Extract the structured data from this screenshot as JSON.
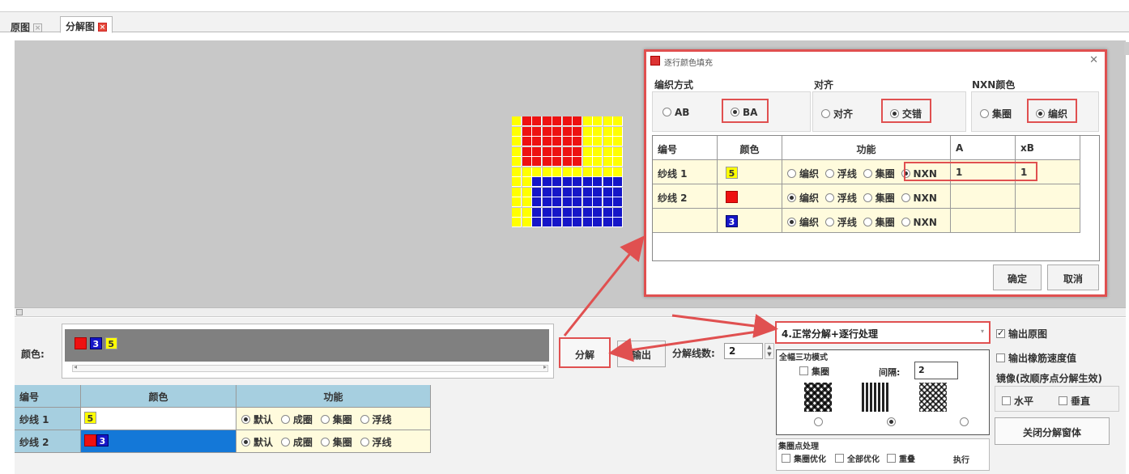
{
  "tabs": [
    {
      "label": "原图"
    },
    {
      "label": "分解图"
    }
  ],
  "dialog": {
    "title": "逐行颜色填充",
    "groups": {
      "weave": {
        "label": "编织方式",
        "options": [
          "AB",
          "BA"
        ],
        "selected": "BA"
      },
      "align": {
        "label": "对齐",
        "options": [
          "对齐",
          "交错"
        ],
        "selected": "交错"
      },
      "nxn": {
        "label": "NXN颜色",
        "options": [
          "集圈",
          "编织"
        ],
        "selected": "编织"
      }
    },
    "table": {
      "headers": [
        "编号",
        "颜色",
        "功能",
        "A",
        "xB"
      ],
      "func_options": [
        "编织",
        "浮线",
        "集圈",
        "NXN"
      ],
      "rows": [
        {
          "id": "纱线 1",
          "color": "5",
          "func": "NXN",
          "a": "1",
          "xb": "1"
        },
        {
          "id": "纱线 2",
          "color": "2",
          "func": "编织",
          "a": "",
          "xb": ""
        },
        {
          "id": "",
          "color": "3",
          "func": "编织",
          "a": "",
          "xb": ""
        }
      ]
    },
    "ok_label": "确定",
    "cancel_label": "取消"
  },
  "bottom": {
    "color_label": "颜色:",
    "colors": [
      "2",
      "3",
      "5"
    ],
    "decompose_label": "分解",
    "output_label": "输出",
    "line_count_label": "分解线数:",
    "line_count_value": "2",
    "mode_select": "4.正常分解+逐行处理",
    "full_mode_label": "全幅三功模式",
    "tuck_label": "集圈",
    "gap_label": "间隔:",
    "gap_value": "2",
    "tuck_process_label": "集圈点处理",
    "tuck_opt_label": "集圈优化",
    "all_opt_label": "全部优化",
    "overlap_label": "重叠",
    "execute_label": "执行",
    "output_original_label": "输出原图",
    "output_rubber_label": "输出橡筋速度值",
    "mirror_label": "镜像(改顺序点分解生效)",
    "horizontal_label": "水平",
    "vertical_label": "垂直",
    "close_label": "关闭分解窗体",
    "table": {
      "headers": [
        "编号",
        "颜色",
        "功能"
      ],
      "func_options": [
        "默认",
        "成圈",
        "集圈",
        "浮线"
      ],
      "rows": [
        {
          "id": "纱线 1",
          "colors": [
            "5"
          ],
          "func": "默认"
        },
        {
          "id": "纱线 2",
          "colors": [
            "2",
            "3"
          ],
          "func": "默认"
        }
      ]
    }
  },
  "colors": {
    "red": "#ee1111",
    "blue": "#1616c8",
    "yellow": "#ffff00",
    "highlight": "#e05050",
    "header": "#a6cfe0"
  }
}
